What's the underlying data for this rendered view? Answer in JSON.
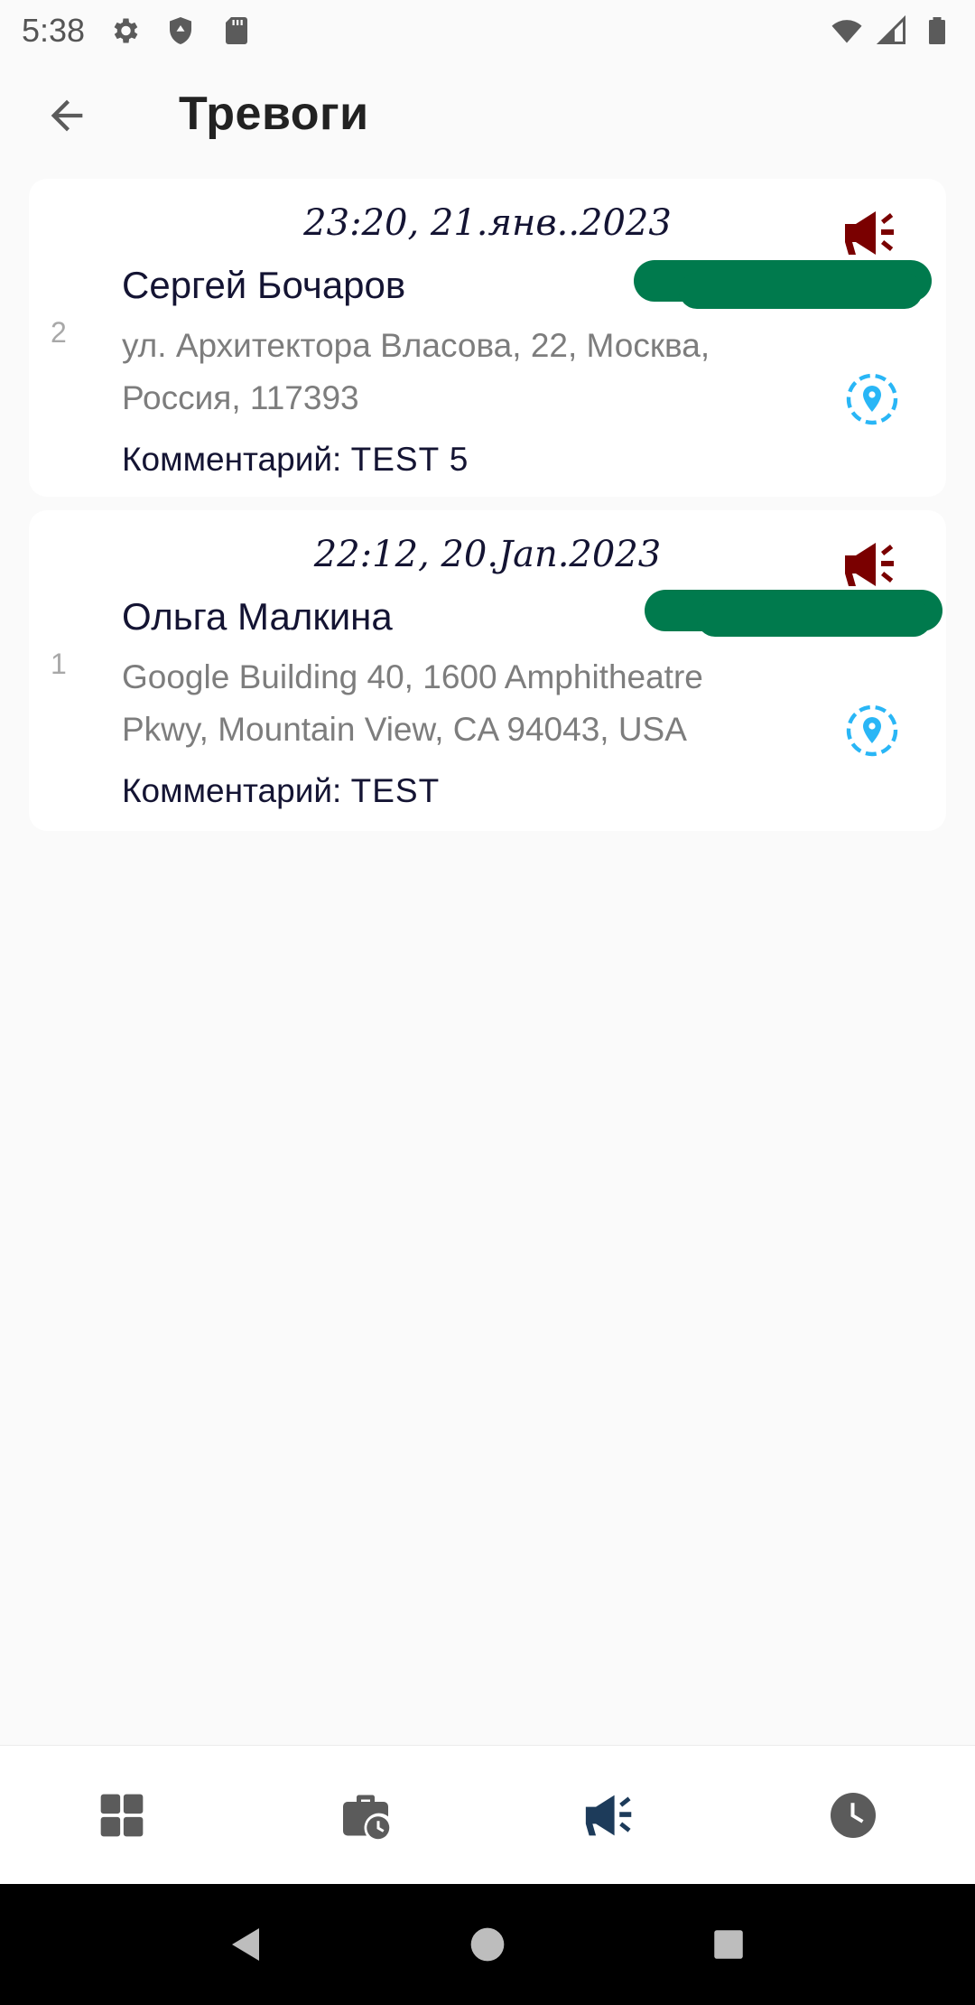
{
  "status_bar": {
    "time": "5:38",
    "icons_left": [
      "gear-icon",
      "shield-icon",
      "sd-card-icon"
    ],
    "icons_right": [
      "wifi-icon",
      "signal-icon",
      "battery-icon"
    ]
  },
  "app_bar": {
    "title": "Тревоги",
    "back_icon": "arrow-back-icon"
  },
  "colors": {
    "alarm_icon": "#7a0000",
    "location_icon": "#29b6f6",
    "nav_active": "#1d3b5a",
    "nav_inactive": "#5b5b5b",
    "redaction": "#007a4d"
  },
  "alerts": [
    {
      "index": "2",
      "datetime": "23:20, 21.янв..2023",
      "name": "Сергей Бочаров",
      "address_line1": "ул. Архитектора Власова, 22, Москва,",
      "address_line2": "Россия, 117393",
      "comment_label": "Комментарий: ",
      "comment_value": "TEST 5"
    },
    {
      "index": "1",
      "datetime": "22:12, 20.Jan.2023",
      "name": "Ольга Малкина",
      "address_line1": "Google Building 40, 1600 Amphitheatre",
      "address_line2": "Pkwy, Mountain View, CA 94043, USA",
      "comment_label": "Комментарий: ",
      "comment_value": "TEST"
    }
  ],
  "bottom_nav": {
    "items": [
      {
        "icon": "dashboard-icon",
        "active": false
      },
      {
        "icon": "briefcase-clock-icon",
        "active": false
      },
      {
        "icon": "megaphone-icon",
        "active": true
      },
      {
        "icon": "clock-icon",
        "active": false
      }
    ]
  },
  "system_nav": [
    "back-triangle-icon",
    "home-circle-icon",
    "recents-square-icon"
  ]
}
